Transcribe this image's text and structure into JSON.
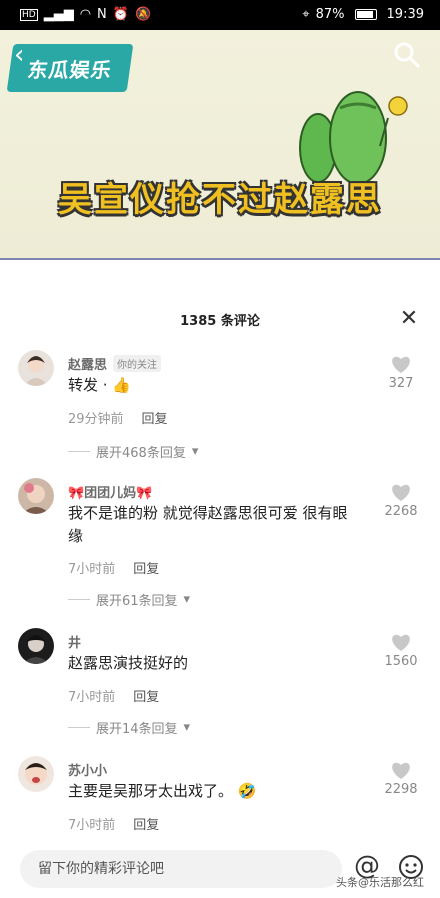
{
  "status_bar": {
    "left_icons": [
      "hd-icon",
      "signal-icon",
      "wifi-icon",
      "nfc-icon",
      "alarm-icon",
      "mute-icon"
    ],
    "battery": "87%",
    "battery_level": 0.87,
    "time": "19:39"
  },
  "video": {
    "brand": "东瓜娱乐",
    "headline": "吴宣仪抢不过赵露思"
  },
  "comments_panel": {
    "title": "1385 条评论",
    "comments": [
      {
        "user": "赵露思",
        "tag": "你的关注",
        "text": "转发 ·",
        "time": "29分钟前",
        "reply": "回复",
        "expand": "展开468条回复",
        "likes": "327"
      },
      {
        "user": "🎀团团儿妈🎀",
        "text": "我不是谁的粉 就觉得赵露思很可爱 很有眼缘",
        "time": "7小时前",
        "reply": "回复",
        "expand": "展开61条回复",
        "likes": "2268"
      },
      {
        "user": "井",
        "text": "赵露思演技挺好的",
        "time": "7小时前",
        "reply": "回复",
        "expand": "展开14条回复",
        "likes": "1560"
      },
      {
        "user": "苏小小",
        "text": "主要是吴那牙太出戏了。",
        "time": "7小时前",
        "reply": "回复",
        "likes": "2298"
      }
    ]
  },
  "input_bar": {
    "placeholder": "留下你的精彩评论吧",
    "at_symbol": "@"
  },
  "watermark": "头条@乐活那么红"
}
